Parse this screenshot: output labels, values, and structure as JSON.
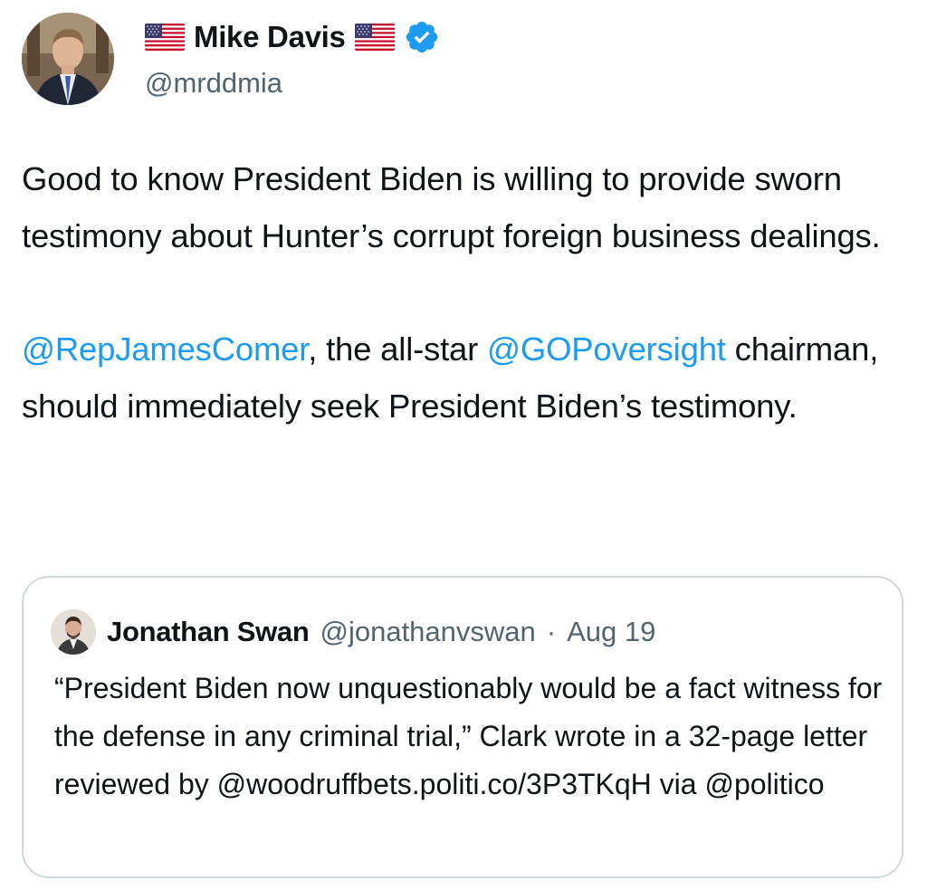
{
  "author": {
    "display_name": "Mike Davis",
    "handle": "@mrddmia",
    "avatar_icon": "profile-photo-man-in-suit",
    "flag_icon": "us-flag-icon",
    "verified_icon": "verified-badge-icon",
    "verified_color": "#1d9bf0"
  },
  "tweet": {
    "paragraph1": "Good to know President Biden is willing to provide sworn testimony about Hunter’s corrupt foreign business dealings.",
    "paragraph2": {
      "mention1": "@RepJamesComer",
      "text1": ", the all-star ",
      "mention2": "@GOPoversight",
      "text2": " chairman, should immediately seek President Biden’s testimony."
    }
  },
  "quoted_tweet": {
    "display_name": "Jonathan Swan",
    "handle": "@jonathanvswan",
    "separator": "·",
    "date": "Aug 19",
    "text": "“President Biden now unquestionably would be a fact witness for the defense in any criminal trial,” Clark wrote in a 32-page letter reviewed by @woodruffbets.politi.co/3P3TKqH via @politico"
  },
  "colors": {
    "text": "#0f1419",
    "secondary": "#536471",
    "link": "#1d9bf0",
    "border": "#cfd9de"
  }
}
